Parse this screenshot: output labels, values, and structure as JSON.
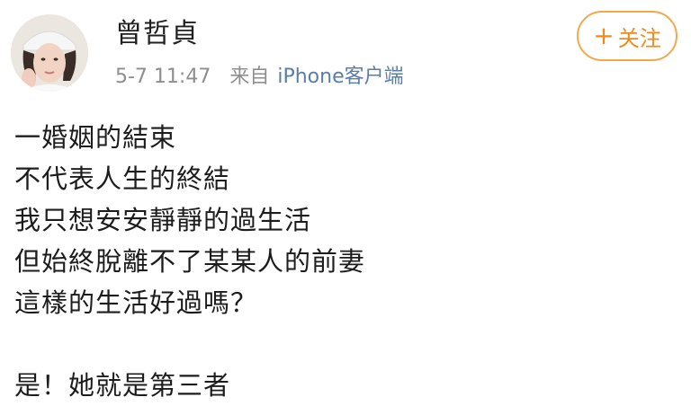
{
  "author": {
    "name": "曾哲貞",
    "avatar_icon": "profile-photo"
  },
  "meta": {
    "time": "5-7 11:47",
    "source_label": "来自",
    "source_app": "iPhone客户端"
  },
  "follow_button": {
    "plus": "+",
    "label": "关注",
    "color": "#f08a1c"
  },
  "content": {
    "lines": [
      "一婚姻的結束",
      "不代表人生的終結",
      "我只想安安靜靜的過生活",
      "但始終脫離不了某某人的前妻",
      "這樣的生活好過嗎？"
    ],
    "next_paragraph": "是！她就是第三者"
  }
}
